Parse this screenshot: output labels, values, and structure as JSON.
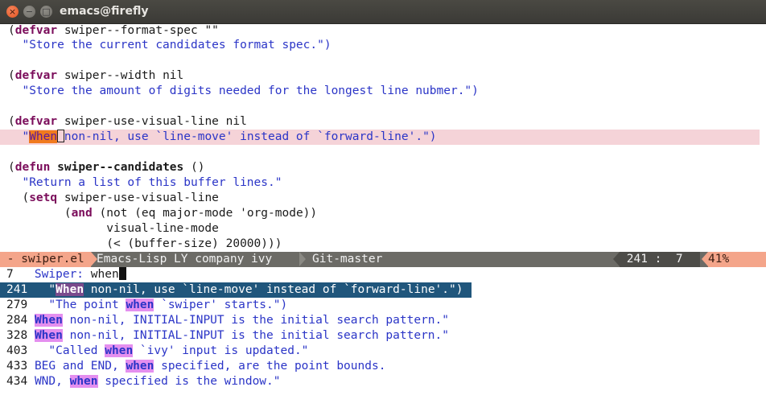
{
  "window": {
    "title": "emacs@firefly",
    "close_glyph": "×",
    "min_glyph": "−",
    "max_glyph": "□"
  },
  "code": {
    "l1a": "(",
    "l1kw": "defvar",
    "l1b": " swiper--format-spec \"\"",
    "l2": "  \"Store the current candidates format spec.\")",
    "l3a": "(",
    "l3kw": "defvar",
    "l3b": " swiper--width nil",
    "l4": "  \"Store the amount of digits needed for the longest line nubmer.\")",
    "l5a": "(",
    "l5kw": "defvar",
    "l5b": " swiper-use-visual-line nil",
    "l6a": "  \"",
    "l6match": "When",
    "l6b": " non-nil, use `line-move' instead of `forward-line'.\")",
    "l7a": "(",
    "l7kw": "defun",
    "l7sp": " ",
    "l7fn": "swiper--candidates",
    "l7b": " ()",
    "l8": "  \"Return a list of this buffer lines.\"",
    "l9a": "  (",
    "l9kw": "setq",
    "l9b": " swiper-use-visual-line",
    "l10a": "        (",
    "l10kw": "and",
    "l10b": " (not (eq major-mode 'org-mode))",
    "l11": "              visual-line-mode",
    "l12": "              (< (buffer-size) 20000)))"
  },
  "modeline": {
    "buffer": " - swiper.el",
    "modes": "Emacs-Lisp LY company ivy",
    "git": "Git-master",
    "position": " 241 :  7",
    "percent": "41%"
  },
  "minibuffer": {
    "count": "7",
    "prompt": "   Swiper: ",
    "input": "when",
    "candidates": [
      {
        "num": "241",
        "pre": "  \"",
        "match": "When",
        "post": " non-nil, use `line-move' instead of `forward-line'.\")"
      },
      {
        "num": "279",
        "pre": "  \"The point ",
        "match": "when",
        "post": " `swiper' starts.\")"
      },
      {
        "num": "284",
        "pre": "",
        "match": "When",
        "post": " non-nil, INITIAL-INPUT is the initial search pattern.\""
      },
      {
        "num": "328",
        "pre": "",
        "match": "When",
        "post": " non-nil, INITIAL-INPUT is the initial search pattern.\""
      },
      {
        "num": "403",
        "pre": "  \"Called ",
        "match": "when",
        "post": " `ivy' input is updated.\""
      },
      {
        "num": "433",
        "pre": "BEG and END, ",
        "match": "when",
        "post": " specified, are the point bounds."
      },
      {
        "num": "434",
        "pre": "WND, ",
        "match": "when",
        "post": " specified is the window.\""
      }
    ]
  },
  "colors": {
    "keyword": "#7b0d5b",
    "string": "#2b35c7",
    "highlight_line": "#f5d3d8",
    "selection": "#20567c",
    "match": "#e48fef",
    "modeline_accent": "#f4a58a"
  }
}
